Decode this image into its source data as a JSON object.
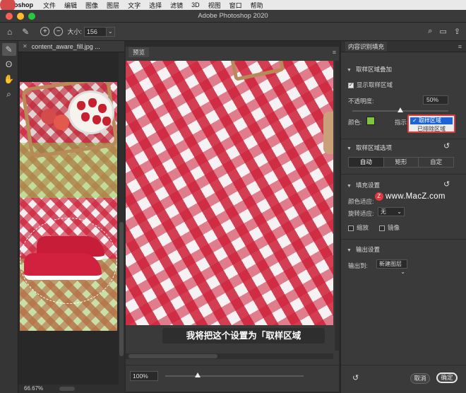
{
  "menubar": {
    "app": "Photoshop",
    "items": [
      "文件",
      "编辑",
      "图像",
      "图层",
      "文字",
      "选择",
      "滤镜",
      "3D",
      "视图",
      "窗口",
      "帮助"
    ]
  },
  "window": {
    "title": "Adobe Photoshop 2020"
  },
  "options": {
    "size_label": "大小:",
    "size_value": "156"
  },
  "document": {
    "tab_title": "content_aware_fill.jpg ...",
    "zoom": "66.67%"
  },
  "preview": {
    "label": "预览",
    "zoom": "100%"
  },
  "caption": "我将把这个设置为「取样区域",
  "watermark": "www.MacZ.com",
  "panel": {
    "title": "内容识别填充",
    "overlay_section": "取样区域叠加",
    "show_sample": "显示取样区域",
    "opacity_label": "不透明度:",
    "opacity_value": "50%",
    "opacity_level": 0.5,
    "color_label": "颜色:",
    "color_value": "#7fc53f",
    "indicate_label": "指示:",
    "indicate_options": [
      "取样区域",
      "已排除区域"
    ],
    "indicate_selected": "取样区域",
    "sample_options_section": "取样区域选项",
    "sample_modes": [
      "自动",
      "矩形",
      "自定"
    ],
    "sample_mode_selected": "自动",
    "fill_section": "填充设置",
    "color_adapt_label": "颜色适应:",
    "rotate_adapt_label": "旋转适应:",
    "rotate_adapt_value": "无",
    "scale_label": "缩放",
    "mirror_label": "镜像",
    "output_section": "输出设置",
    "output_label": "输出到:",
    "output_value": "新建图层",
    "cancel": "取消",
    "ok": "确定"
  }
}
